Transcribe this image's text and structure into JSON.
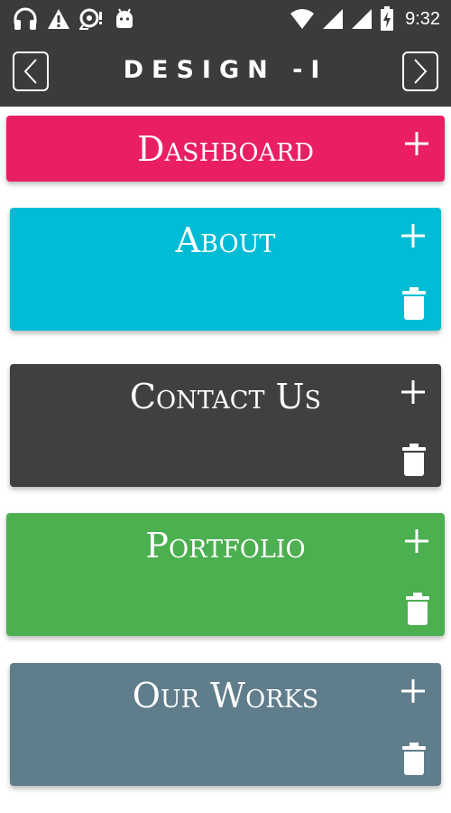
{
  "status_bar": {
    "time": "9:32",
    "icons": [
      "headphones-icon",
      "warning-icon",
      "vpn-key-icon",
      "android-icon",
      "wifi-icon",
      "signal-icon",
      "signal-icon",
      "battery-charging-icon"
    ]
  },
  "toolbar": {
    "title": "DESIGN -I",
    "prev_icon": "chevron-left-icon",
    "next_icon": "chevron-right-icon"
  },
  "cards": [
    {
      "title": "Dashboard",
      "color": "#e91e63",
      "add_icon": "plus-icon",
      "has_delete": false
    },
    {
      "title": "About",
      "color": "#00bcd4",
      "add_icon": "plus-icon",
      "delete_icon": "trash-icon",
      "has_delete": true
    },
    {
      "title": "Contact Us",
      "color": "#404040",
      "add_icon": "plus-icon",
      "delete_icon": "trash-icon",
      "has_delete": true
    },
    {
      "title": "Portfolio",
      "color": "#4caf50",
      "add_icon": "plus-icon",
      "delete_icon": "trash-icon",
      "has_delete": true
    },
    {
      "title": "Our Works",
      "color": "#607d8b",
      "add_icon": "plus-icon",
      "delete_icon": "trash-icon",
      "has_delete": true
    }
  ],
  "colors": {
    "bar_background": "#3b3b3b",
    "page_background": "#ffffff"
  }
}
